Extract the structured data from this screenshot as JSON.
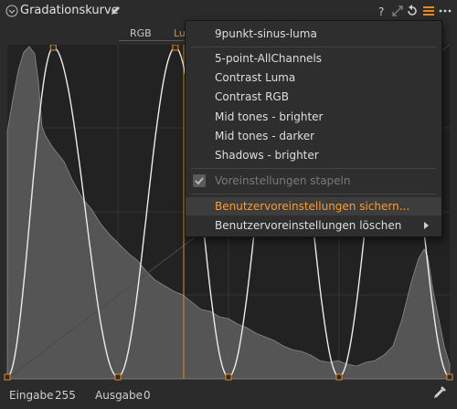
{
  "panel": {
    "title": "Gradationskurve",
    "tabs": [
      {
        "label": "RGB"
      },
      {
        "label": "Lu"
      }
    ]
  },
  "footer": {
    "input_label": "Eingabe",
    "input_value": "255",
    "output_label": "Ausgabe",
    "output_value": "0"
  },
  "menu": {
    "items": [
      {
        "label": "9punkt-sinus-luma"
      },
      {
        "label": "5-point-AllChannels"
      },
      {
        "label": "Contrast Luma"
      },
      {
        "label": "Contrast RGB"
      },
      {
        "label": "Mid tones - brighter"
      },
      {
        "label": "Mid tones - darker"
      },
      {
        "label": "Shadows - brighter"
      }
    ],
    "stack_label": "Voreinstellungen stapeln",
    "save_label": "Benutzervoreinstellungen sichern...",
    "delete_label": "Benutzervoreinstellungen löschen"
  },
  "colors": {
    "accent": "#e88a1a",
    "curve": "#ececec",
    "histogram": "#5e5e5e",
    "graph_bg": "#222222"
  },
  "icons": [
    "chevron-down-icon",
    "pencil-icon",
    "help-icon",
    "reset-icon",
    "menu-icon",
    "more-icon",
    "eyedropper-icon"
  ]
}
